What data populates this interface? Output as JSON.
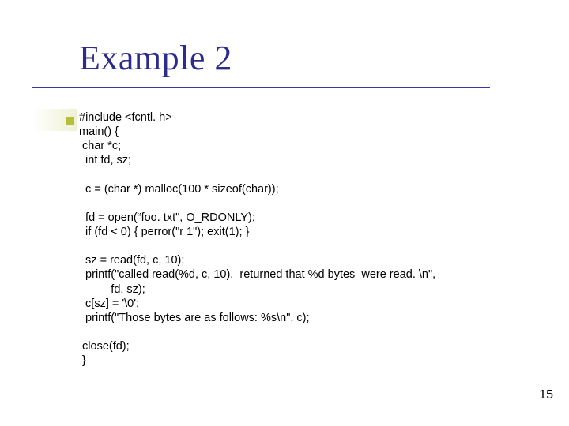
{
  "slide": {
    "title": "Example 2",
    "page_number": "15",
    "code": "#include <fcntl. h>\nmain() {\n char *c;\n  int fd, sz;\n\n  c = (char *) malloc(100 * sizeof(char));\n\n  fd = open(“foo. txt\", O_RDONLY);\n  if (fd < 0) { perror(\"r 1\"); exit(1); }\n\n  sz = read(fd, c, 10);\n  printf(\"called read(%d, c, 10).  returned that %d bytes  were read. \\n\",\n          fd, sz);\n  c[sz] = '\\0';\n  printf(\"Those bytes are as follows: %s\\n\", c);\n\n close(fd);\n }"
  }
}
